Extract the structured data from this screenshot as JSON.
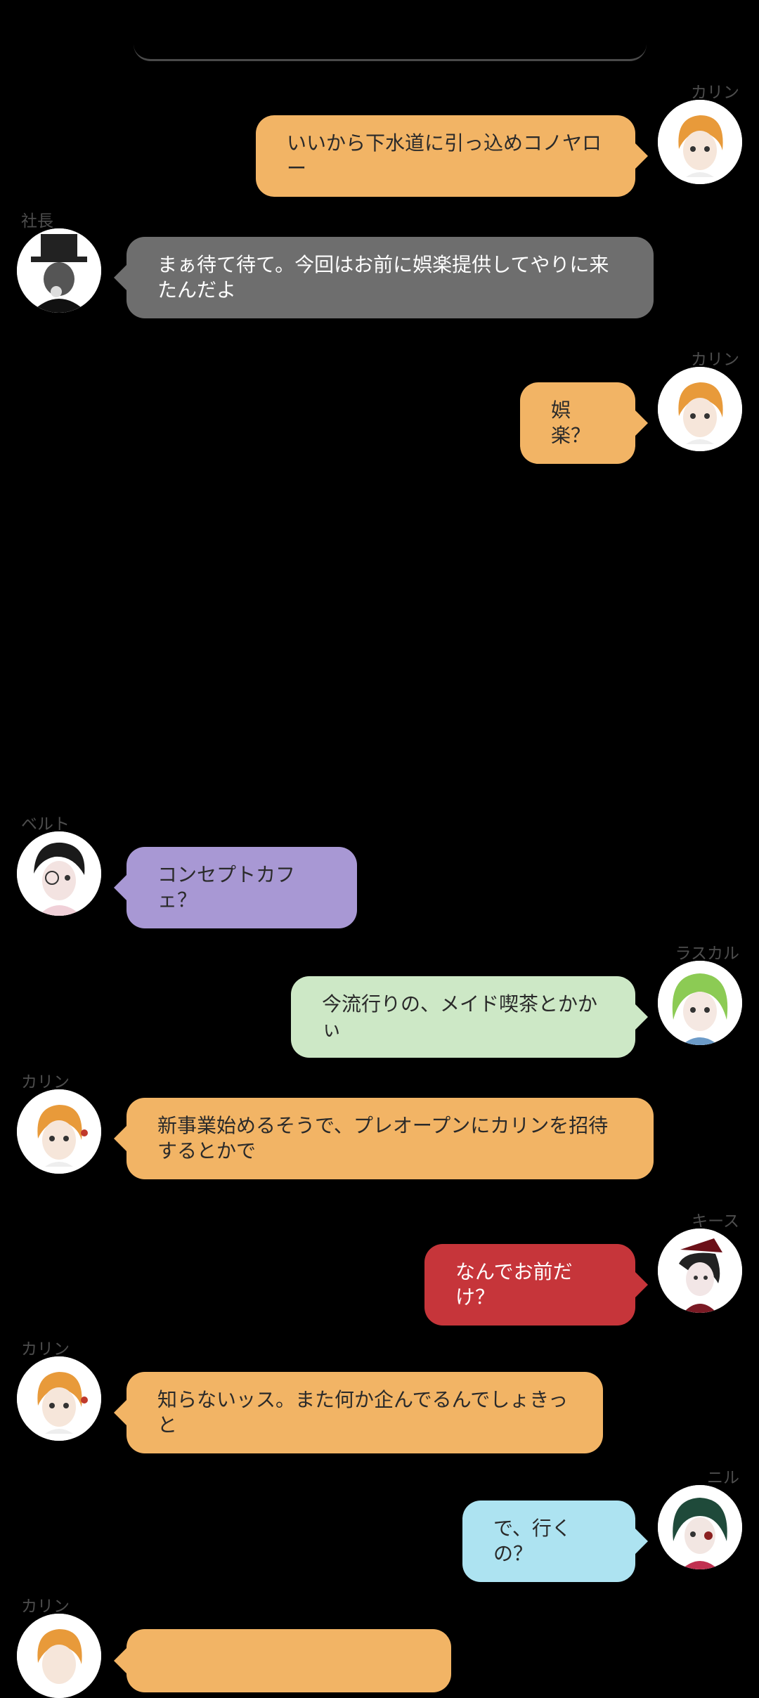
{
  "colors": {
    "background": "#000000",
    "karin": "#F2B465",
    "shachou": "#6E6E6E",
    "belt": "#A898D4",
    "rascal": "#CDE8C6",
    "keith": "#C6353A",
    "nil": "#ADE3F1",
    "name_label": "#4D4D4D"
  },
  "messages": [
    {
      "speaker": "カリン",
      "side": "right",
      "text": "いいから下水道に引っ込めコノヤロー",
      "color": "#F2B465",
      "avatar": "karin-avatar-icon"
    },
    {
      "speaker": "社長",
      "side": "left",
      "text": "まぁ待て待て。今回はお前に娯楽提供してやりに来たんだよ",
      "color": "#6E6E6E",
      "avatar": "shachou-avatar-icon"
    },
    {
      "speaker": "カリン",
      "side": "right",
      "text": "娯楽？",
      "color": "#F2B465",
      "avatar": "karin-avatar-icon"
    },
    {
      "speaker": "ベルト",
      "side": "left",
      "text": "コンセプトカフェ？",
      "color": "#A898D4",
      "avatar": "belt-avatar-icon"
    },
    {
      "speaker": "ラスカル",
      "side": "right",
      "text": "今流行りの、メイド喫茶とかかぃ",
      "color": "#CDE8C6",
      "avatar": "rascal-avatar-icon"
    },
    {
      "speaker": "カリン",
      "side": "left",
      "text": "新事業始めるそうで、プレオープンにカリンを招待するとかで",
      "color": "#F2B465",
      "avatar": "karin-avatar-icon"
    },
    {
      "speaker": "キース",
      "side": "right",
      "text": "なんでお前だけ？",
      "color": "#C6353A",
      "avatar": "keith-avatar-icon"
    },
    {
      "speaker": "カリン",
      "side": "left",
      "text": "知らないッス。また何か企んでるんでしょきっと",
      "color": "#F2B465",
      "avatar": "karin-avatar-icon"
    },
    {
      "speaker": "ニル",
      "side": "right",
      "text": "で、行くの？",
      "color": "#ADE3F1",
      "avatar": "nil-avatar-icon"
    },
    {
      "speaker": "カリン",
      "side": "left",
      "text": "",
      "color": "#F2B465",
      "avatar": "karin-avatar-icon"
    }
  ]
}
